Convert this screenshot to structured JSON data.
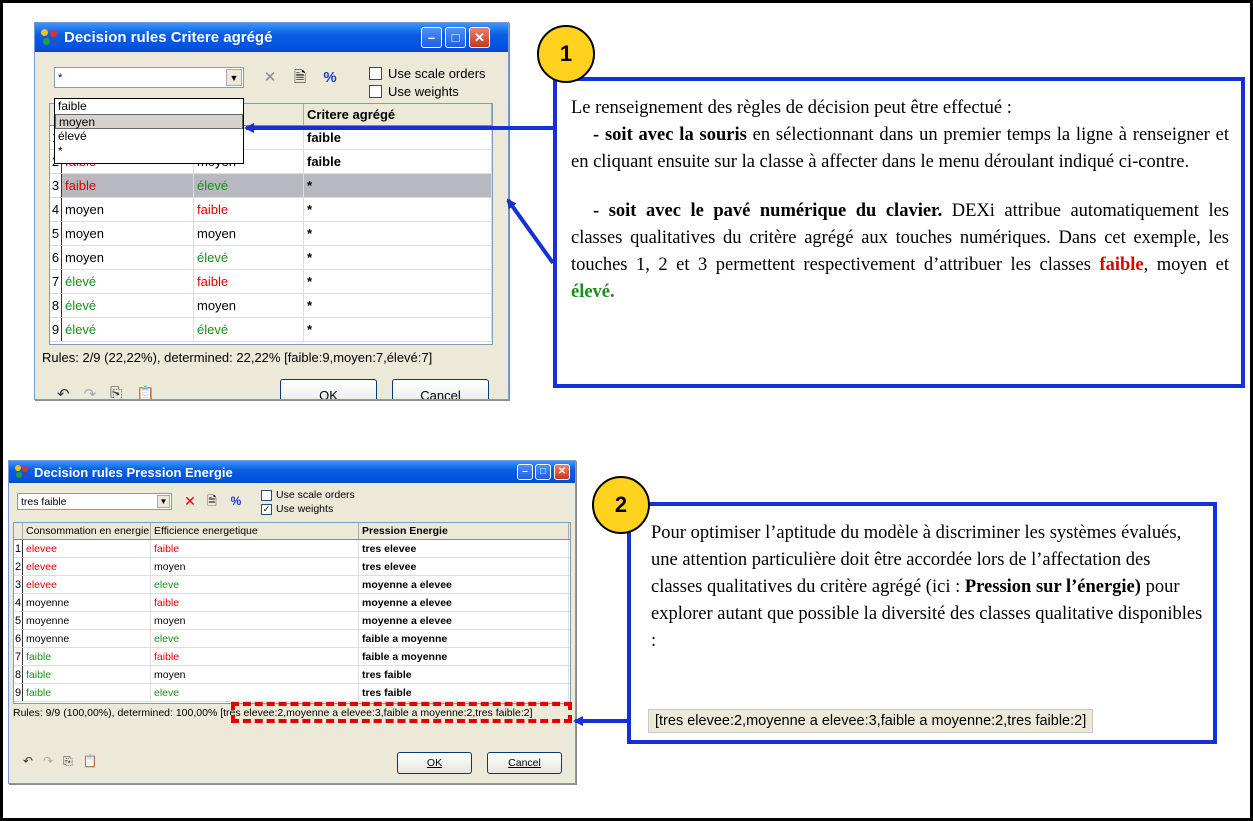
{
  "window1": {
    "title": "Decision rules Critere agrégé",
    "combo_value": "*",
    "use_scale_orders": "Use scale orders",
    "use_weights": "Use weights",
    "header_target": "Critere agrégé",
    "dropdown": [
      "faible",
      "moyen",
      "élevé",
      "*"
    ],
    "rows": [
      {
        "n": "1",
        "a": "",
        "b": "",
        "c": "faible",
        "ac": "",
        "bc": ""
      },
      {
        "n": "2",
        "a": "faible",
        "b": "moyen",
        "c": "faible",
        "ac": "red",
        "bc": ""
      },
      {
        "n": "3",
        "a": "faible",
        "b": "élevé",
        "c": "*",
        "ac": "red",
        "bc": "green"
      },
      {
        "n": "4",
        "a": "moyen",
        "b": "faible",
        "c": "*",
        "ac": "",
        "bc": "red"
      },
      {
        "n": "5",
        "a": "moyen",
        "b": "moyen",
        "c": "*",
        "ac": "",
        "bc": ""
      },
      {
        "n": "6",
        "a": "moyen",
        "b": "élevé",
        "c": "*",
        "ac": "",
        "bc": "green"
      },
      {
        "n": "7",
        "a": "élevé",
        "b": "faible",
        "c": "*",
        "ac": "green",
        "bc": "red"
      },
      {
        "n": "8",
        "a": "élevé",
        "b": "moyen",
        "c": "*",
        "ac": "green",
        "bc": ""
      },
      {
        "n": "9",
        "a": "élevé",
        "b": "élevé",
        "c": "*",
        "ac": "green",
        "bc": "green"
      }
    ],
    "status": "Rules: 2/9 (22,22%), determined: 22,22% [faible:9,moyen:7,élevé:7]",
    "ok": "OK",
    "cancel": "Cancel"
  },
  "callout1": {
    "badge": "1",
    "intro": "Le renseignement des règles de décision peut être effectué :",
    "p1_bold": "- soit avec la souris",
    "p1_rest": " en sélectionnant dans un premier temps la ligne à renseigner et en cliquant ensuite sur la classe à affecter dans le menu déroulant indiqué ci-contre.",
    "p2_bold": "- soit avec le pavé numérique du clavier.",
    "p2_rest": " DEXi attribue automatiquement les classes qualitatives du critère agrégé aux touches numériques. Dans cet exemple, les touches 1, 2 et 3 permettent respectivement d’attribuer les classes ",
    "w_faible": "faible",
    "w_comma": ",",
    "w_moyen": " moyen et ",
    "w_eleve": "élevé."
  },
  "window2": {
    "title": "Decision rules Pression Energie",
    "combo_value": "tres faible",
    "use_scale_orders": "Use scale orders",
    "use_weights": "Use weights",
    "headers": [
      "Consommation en energie",
      "Efficience energetique",
      "Pression Energie"
    ],
    "rows": [
      {
        "n": "1",
        "a": "elevee",
        "b": "faible",
        "c": "tres elevee",
        "ac": "red",
        "bc": "red"
      },
      {
        "n": "2",
        "a": "elevee",
        "b": "moyen",
        "c": "tres elevee",
        "ac": "red",
        "bc": ""
      },
      {
        "n": "3",
        "a": "elevee",
        "b": "eleve",
        "c": "moyenne a elevee",
        "ac": "red",
        "bc": "green"
      },
      {
        "n": "4",
        "a": "moyenne",
        "b": "faible",
        "c": "moyenne a elevee",
        "ac": "",
        "bc": "red"
      },
      {
        "n": "5",
        "a": "moyenne",
        "b": "moyen",
        "c": "moyenne a elevee",
        "ac": "",
        "bc": ""
      },
      {
        "n": "6",
        "a": "moyenne",
        "b": "eleve",
        "c": "faible a moyenne",
        "ac": "",
        "bc": "green"
      },
      {
        "n": "7",
        "a": "faible",
        "b": "faible",
        "c": "faible a moyenne",
        "ac": "green",
        "bc": "red"
      },
      {
        "n": "8",
        "a": "faible",
        "b": "moyen",
        "c": "tres faible",
        "ac": "green",
        "bc": ""
      },
      {
        "n": "9",
        "a": "faible",
        "b": "eleve",
        "c": "tres faible",
        "ac": "green",
        "bc": "green"
      }
    ],
    "status_prefix": "Rules: 9/9 (100,00%), determined: 100,00%",
    "status_dist": " [tres elevee:2,moyenne a elevee:3,faible a moyenne:2,tres faible:2]",
    "ok": "OK",
    "cancel": "Cancel"
  },
  "callout2": {
    "badge": "2",
    "text_before": "Pour optimiser l’aptitude du modèle à discriminer les systèmes évalués, une attention particulière doit être accordée lors de l’affectation des classes qualitatives du critère agrégé (ici : ",
    "text_bold": "Pression sur l’énergie)",
    "text_after": " pour explorer autant que possible la diversité des classes qualitative disponibles :",
    "distribution": "[tres elevee:2,moyenne a elevee:3,faible a moyenne:2,tres faible:2]"
  },
  "colors": {
    "callout_border": "#1530d8",
    "badge": "#ffd21f",
    "red": "#e00000",
    "green": "#189018"
  },
  "icons": [
    "app-icon",
    "minimize-icon",
    "maximize-icon",
    "close-icon",
    "delete-icon",
    "copy-rules-icon",
    "percent-icon",
    "undo-icon",
    "redo-icon",
    "copy-icon",
    "paste-icon",
    "dropdown-arrow-icon"
  ]
}
